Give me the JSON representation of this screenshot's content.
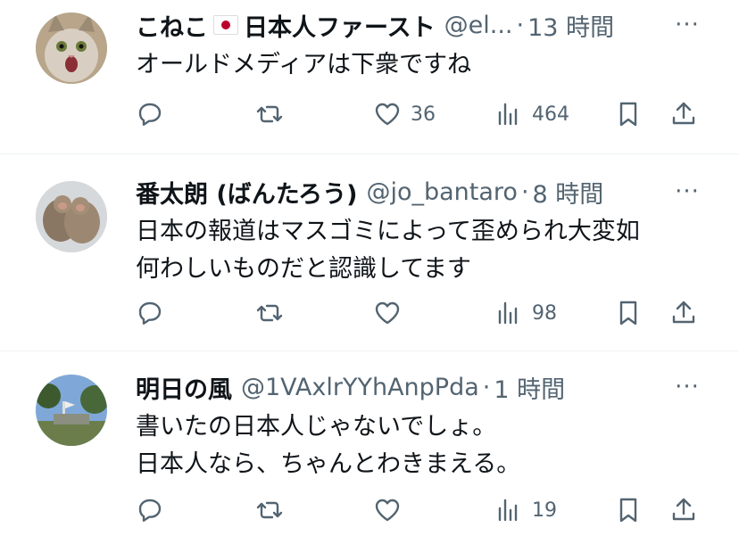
{
  "tweets": [
    {
      "name": "こねこ",
      "name_suffix": "日本人ファースト",
      "has_flag": true,
      "handle": "@el...",
      "separator": "·",
      "time": "13 時間",
      "lines": [
        "オールドメディアは下衆ですね"
      ],
      "counts": {
        "reply": "",
        "retweet": "",
        "like": "36",
        "views": "464"
      },
      "avatar_icon": "cat-avatar"
    },
    {
      "name": "番太朗 (ばんたろう)",
      "name_suffix": "",
      "has_flag": false,
      "handle": "@jo_bantaro",
      "separator": "·",
      "time": "8 時間",
      "lines": [
        "日本の報道はマスゴミによって歪められ大変如",
        "何わしいものだと認識してます"
      ],
      "counts": {
        "reply": "",
        "retweet": "",
        "like": "",
        "views": "98"
      },
      "avatar_icon": "monkeys-avatar"
    },
    {
      "name": "明日の風",
      "name_suffix": "",
      "has_flag": false,
      "handle": "@1VAxlrYYhAnpPda",
      "separator": "·",
      "time": "1 時間",
      "lines": [
        "書いたの日本人じゃないでしょ。",
        "日本人なら、ちゃんとわきまえる。"
      ],
      "counts": {
        "reply": "",
        "retweet": "",
        "like": "",
        "views": "19"
      },
      "avatar_icon": "landscape-avatar"
    }
  ],
  "more_label": "···",
  "colors": {
    "text": "#0f1419",
    "secondary": "#536471",
    "divider": "#eff3f4",
    "flag_red": "#bc002d"
  }
}
